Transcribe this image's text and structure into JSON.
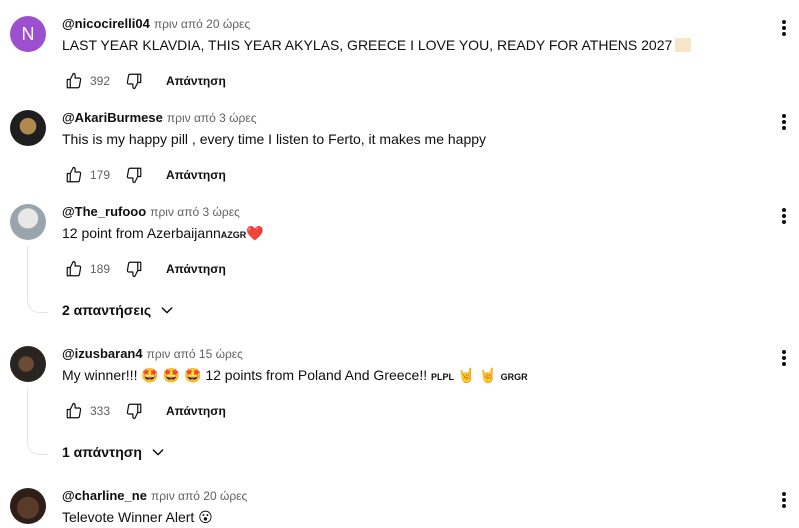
{
  "reply_label": "Απάντηση",
  "comments": [
    {
      "handle": "@nicocirelli04",
      "time": "πριν από 20 ώρες",
      "avatar_letter": "N",
      "text": "LAST YEAR KLAVDIA, THIS YEAR AKYLAS, GREECE I LOVE YOU, READY FOR ATHENS 2027",
      "text_emoji": "🏳",
      "likes": "392"
    },
    {
      "handle": "@AkariBurmese",
      "time": "πριν από 3 ώρες",
      "text": "This is my happy pill , every time I listen to Ferto, it makes me happy",
      "likes": "179"
    },
    {
      "handle": "@The_rufooo",
      "time": "πριν από 3 ώρες",
      "text": "12 point from Azerbaijann",
      "text_small": "AZGR",
      "text_emoji": "❤️",
      "likes": "189",
      "replies_label": "2 απαντήσεις"
    },
    {
      "handle": "@izusbaran4",
      "time": "πριν από 15 ώρες",
      "text_a": "My winner!!! ",
      "emoji_eyes": "🤩 🤩 🤩",
      "text_b": " 12 points from Poland And Greece!! ",
      "small_a": "PLPL",
      "emoji_horns": "🤘 🤘",
      "small_b": "GRGR",
      "likes": "333",
      "replies_label": "1 απάντηση"
    },
    {
      "handle": "@charline_ne",
      "time": "πριν από 20 ώρες",
      "text": "Televote Winner Alert ",
      "text_emoji": "😮"
    }
  ]
}
